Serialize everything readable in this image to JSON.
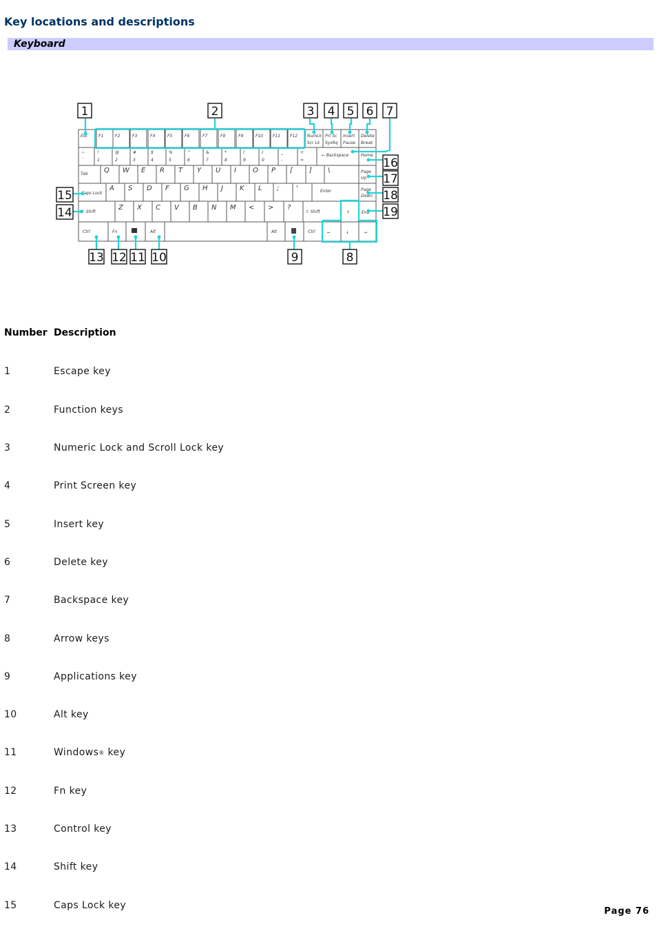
{
  "header": {
    "title": "Key locations and descriptions",
    "section": "Keyboard"
  },
  "figure": {
    "accent_color": "#22d3d8",
    "callouts": [
      "1",
      "2",
      "3",
      "4",
      "5",
      "6",
      "7",
      "8",
      "9",
      "10",
      "11",
      "12",
      "13",
      "14",
      "15",
      "16",
      "17",
      "18",
      "19"
    ],
    "keys": {
      "esc": "Esc",
      "f": [
        "F1",
        "F2",
        "F3",
        "F4",
        "F5",
        "F6",
        "F7",
        "F8",
        "F9",
        "F10",
        "F11",
        "F12"
      ],
      "numlk": [
        "NumLk",
        "Scr Lk"
      ],
      "prtsc": [
        "Prt Sc",
        "SysRq"
      ],
      "insert": [
        "Insert",
        "Pause"
      ],
      "delete": [
        "Delete",
        "Break"
      ],
      "backspace": "← Backspace",
      "home": "Home",
      "pgup": [
        "Page",
        "Up"
      ],
      "pgdn": [
        "Page",
        "Down"
      ],
      "end": "End",
      "tab": "Tab",
      "caps": "Caps Lock",
      "shift": "⇧ Shift",
      "enter": "Enter",
      "ctrl": "Ctrl",
      "fn": "Fn",
      "alt": "Alt",
      "num_row_top": [
        "~",
        "!",
        "@",
        "#",
        "$",
        "%",
        "^",
        "&",
        "*",
        "(",
        ")",
        "_",
        "+"
      ],
      "num_row_bottom": [
        "`",
        "1",
        "2",
        "3",
        "4",
        "5",
        "6",
        "7",
        "8",
        "9",
        "0",
        "-",
        "="
      ],
      "qwerty": [
        "Q",
        "W",
        "E",
        "R",
        "T",
        "Y",
        "U",
        "I",
        "O",
        "P",
        "[",
        "]",
        "\\"
      ],
      "asdf": [
        "A",
        "S",
        "D",
        "F",
        "G",
        "H",
        "J",
        "K",
        "L",
        ";",
        "'"
      ],
      "zxcv": [
        "Z",
        "X",
        "C",
        "V",
        "B",
        "N",
        "M",
        "<",
        ">",
        "?"
      ],
      "arrows": [
        "↑",
        "←",
        "↓",
        "→"
      ]
    }
  },
  "table": {
    "headers": [
      "Number",
      "Description"
    ],
    "rows": [
      {
        "number": "1",
        "description": "Escape key"
      },
      {
        "number": "2",
        "description": "Function keys"
      },
      {
        "number": "3",
        "description": "Numeric Lock and Scroll Lock key"
      },
      {
        "number": "4",
        "description": "Print Screen key"
      },
      {
        "number": "5",
        "description": "Insert key"
      },
      {
        "number": "6",
        "description": "Delete key"
      },
      {
        "number": "7",
        "description": "Backspace key"
      },
      {
        "number": "8",
        "description": "Arrow keys"
      },
      {
        "number": "9",
        "description": "Applications key"
      },
      {
        "number": "10",
        "description": "Alt key"
      },
      {
        "number": "11",
        "description": "Windows",
        "sup": "®",
        "suffix": " key"
      },
      {
        "number": "12",
        "description": "Fn key"
      },
      {
        "number": "13",
        "description": "Control key"
      },
      {
        "number": "14",
        "description": "Shift key"
      },
      {
        "number": "15",
        "description": "Caps Lock key"
      }
    ]
  },
  "footer": {
    "page": "Page 76"
  }
}
